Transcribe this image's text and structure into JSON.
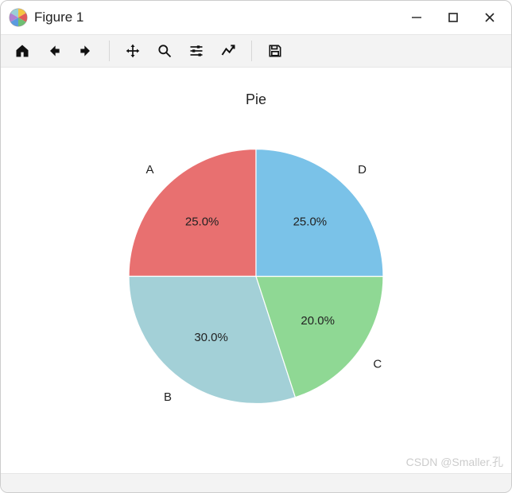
{
  "window": {
    "title": "Figure 1"
  },
  "chart_data": {
    "type": "pie",
    "title": "Pie",
    "categories": [
      "A",
      "B",
      "C",
      "D"
    ],
    "values": [
      25.0,
      30.0,
      20.0,
      25.0
    ],
    "start_angle_deg": 90,
    "counterclockwise": true,
    "colors": [
      "#e87070",
      "#a3d0d7",
      "#8fd894",
      "#7ac2e8"
    ],
    "autopct_labels": [
      "25.0%",
      "30.0%",
      "20.0%",
      "25.0%"
    ]
  },
  "watermark": "CSDN @Smaller.孔"
}
